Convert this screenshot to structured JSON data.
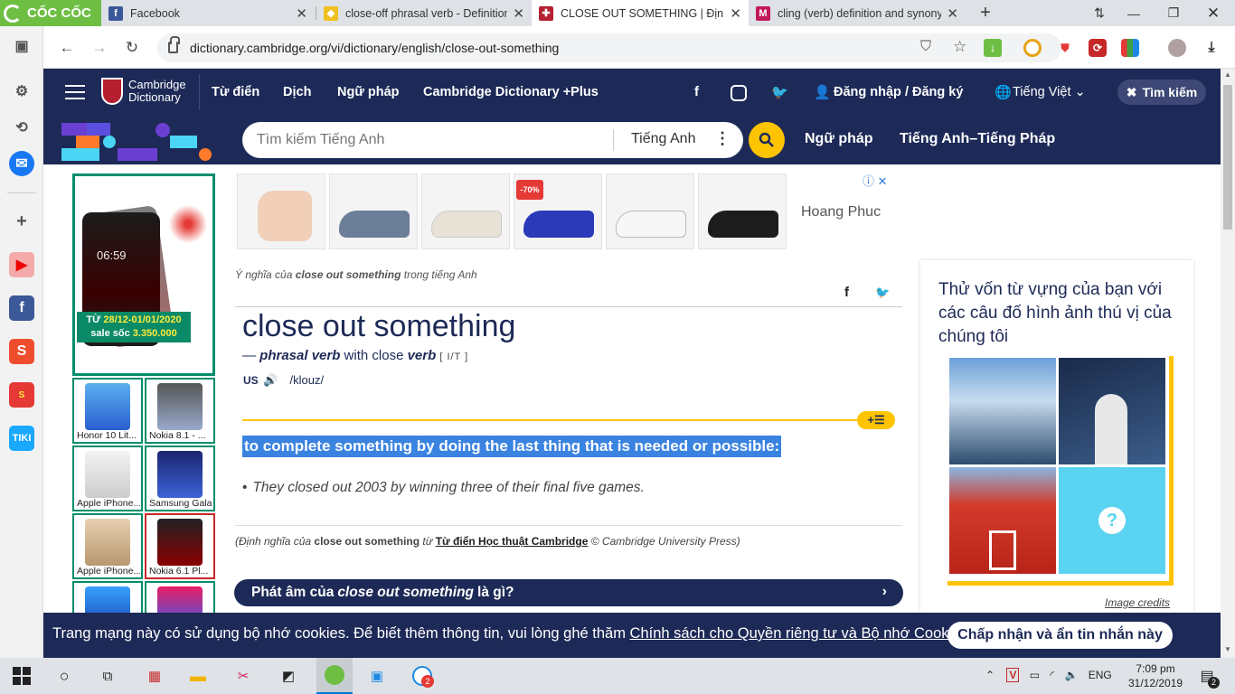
{
  "browser": {
    "brand": "CỐC CỐC",
    "tabs": [
      {
        "title": "Facebook",
        "icon": "facebook-icon"
      },
      {
        "title": "close-off phrasal verb - Definition,",
        "icon": "oxford-icon"
      },
      {
        "title": "CLOSE OUT SOMETHING | Định ng",
        "icon": "cambridge-icon"
      },
      {
        "title": "cling (verb) definition and synonym",
        "icon": "macmillan-icon"
      }
    ],
    "new_tab_label": "+",
    "address": "dictionary.cambridge.org/vi/dictionary/english/close-out-something"
  },
  "site": {
    "logo_line1": "Cambridge",
    "logo_line2": "Dictionary",
    "nav": [
      "Từ điển",
      "Dịch",
      "Ngữ pháp",
      "Cambridge Dictionary +Plus"
    ],
    "login": "Đăng nhập / Đăng ký",
    "language": "Tiếng Việt",
    "search_button": "Tìm kiếm",
    "search_placeholder": "Tìm kiếm Tiếng Anh",
    "search_lang": "Tiếng Anh",
    "search_links": [
      "Ngữ pháp",
      "Tiếng Anh–Tiếng Pháp"
    ]
  },
  "ad_left": {
    "phone_time": "06:59",
    "promo_line1_prefix": "TỪ ",
    "promo_line1_date": "28/12-01/01/2020",
    "promo_line2_prefix": "sale sốc ",
    "promo_line2_price": "3.350.000",
    "thumbs": [
      "Honor 10 Lit...",
      "Nokia 8.1 - ...",
      "Apple iPhone...",
      "Samsung Gala...",
      "Apple iPhone...",
      "Nokia 6.1 Pl..."
    ]
  },
  "ad_top": {
    "brand": "Hoang Phuc",
    "discount": "-70%"
  },
  "entry": {
    "crumb_prefix": "Ý nghĩa của ",
    "crumb_word": "close out something",
    "crumb_suffix": " trong tiếng Anh",
    "headword": "close out something",
    "pos_prefix": "— ",
    "pos": "phrasal verb",
    "with_word": " with close ",
    "verb_label": "verb",
    "grammar": " [ I/T ]",
    "region": "US",
    "ipa": "/klouz/",
    "definition": "to complete something by doing the last thing that is needed or possible:",
    "example": "They closed out 2003 by winning three of their final five games.",
    "source_prefix": "(Định nghĩa của ",
    "source_word": "close out something",
    "source_mid": " từ ",
    "source_link": "Từ điển Học thuật Cambridge",
    "source_suffix": " © Cambridge University Press)",
    "pron_prefix": "Phát âm của ",
    "pron_word": "close out something",
    "pron_suffix": " là gì?"
  },
  "quiz": {
    "title": "Thử vốn từ vựng của bạn với các câu đố hình ảnh thú vị của chúng tôi",
    "credits": "Image credits",
    "question_mark": "?"
  },
  "cookie": {
    "text": "Trang mạng này có sử dụng bộ nhớ cookies. Để biết thêm thông tin, vui lòng ghé thăm ",
    "link": "Chính sách cho Quyền riêng tư và Bộ nhớ Cookies",
    "end": ".",
    "button": "Chấp nhận và ẩn tin nhắn này"
  },
  "taskbar": {
    "language": "ENG",
    "time": "7:09 pm",
    "date": "31/12/2019",
    "notif_count": "2",
    "zalo_badge": "2"
  },
  "colors": {
    "cambridge_navy": "#1d2a57",
    "cambridge_yellow": "#fec400",
    "coccoc_green": "#6fbe44",
    "highlight": "#3a83e0"
  }
}
